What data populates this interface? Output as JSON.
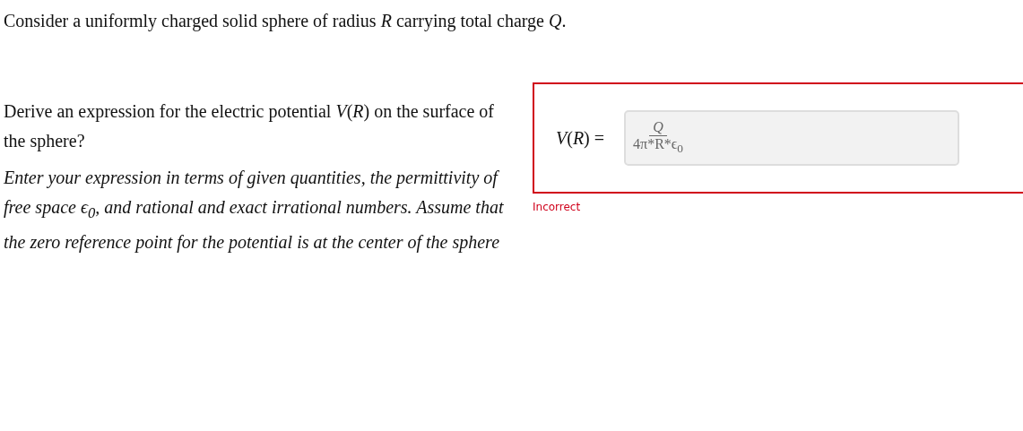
{
  "intro": "Consider a uniformly charged solid sphere of radius *R* carrying total charge *Q*.",
  "question": "Derive an expression for the electric potential *V*(*R*) on the surface of the sphere?",
  "instructions": "Enter your expression in terms of given quantities, the permittivity of free space ϵ$_{0}$, and rational and exact irrational numbers. Assume that the zero reference point for the potential is at the center of the sphere",
  "answer": {
    "label": "*V*(*R*) =",
    "numerator": "*Q*",
    "denominator": "4π*R*ϵ$_{0}$",
    "disabled": true,
    "correct": false,
    "feedback": "Incorrect"
  }
}
